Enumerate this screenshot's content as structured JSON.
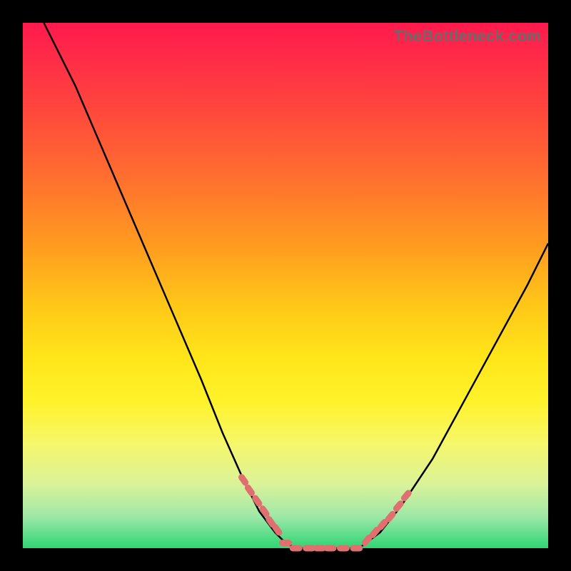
{
  "watermark": "TheBottleneck.com",
  "colors": {
    "background_frame": "#000000",
    "curve": "#000000",
    "marker": "#e07070",
    "gradient_top": "#ff1a4d",
    "gradient_bottom": "#2ed573"
  },
  "chart_data": {
    "type": "line",
    "title": "",
    "xlabel": "",
    "ylabel": "",
    "xlim": [
      0,
      100
    ],
    "ylim": [
      0,
      100
    ],
    "grid": false,
    "legend": false,
    "series": [
      {
        "name": "curve-left",
        "x": [
          4,
          10,
          16,
          22,
          28,
          34,
          38,
          42,
          45,
          48,
          50,
          52
        ],
        "y": [
          100,
          88,
          74,
          60,
          46,
          32,
          22,
          13,
          7,
          3,
          1,
          0
        ]
      },
      {
        "name": "floor",
        "x": [
          52,
          55,
          58,
          61,
          64
        ],
        "y": [
          0,
          0,
          0,
          0,
          0
        ]
      },
      {
        "name": "curve-right",
        "x": [
          64,
          68,
          72,
          78,
          84,
          90,
          96,
          100
        ],
        "y": [
          0,
          3,
          8,
          17,
          28,
          39,
          50,
          58
        ]
      }
    ],
    "markers": [
      {
        "name": "left-entry",
        "x": [
          42,
          43.2,
          44.6,
          46,
          47.2,
          48.4
        ],
        "y": [
          13,
          11,
          9,
          7,
          5,
          3.5
        ]
      },
      {
        "name": "floor-cluster",
        "x": [
          50,
          52,
          54.5,
          56.5,
          58.5,
          61,
          63.5
        ],
        "y": [
          1,
          0,
          0,
          0,
          0,
          0,
          0
        ]
      },
      {
        "name": "right-rise",
        "x": [
          65.5,
          67,
          68.5,
          70,
          71.5,
          73
        ],
        "y": [
          1.5,
          3,
          4.5,
          6,
          8,
          10
        ]
      }
    ]
  }
}
